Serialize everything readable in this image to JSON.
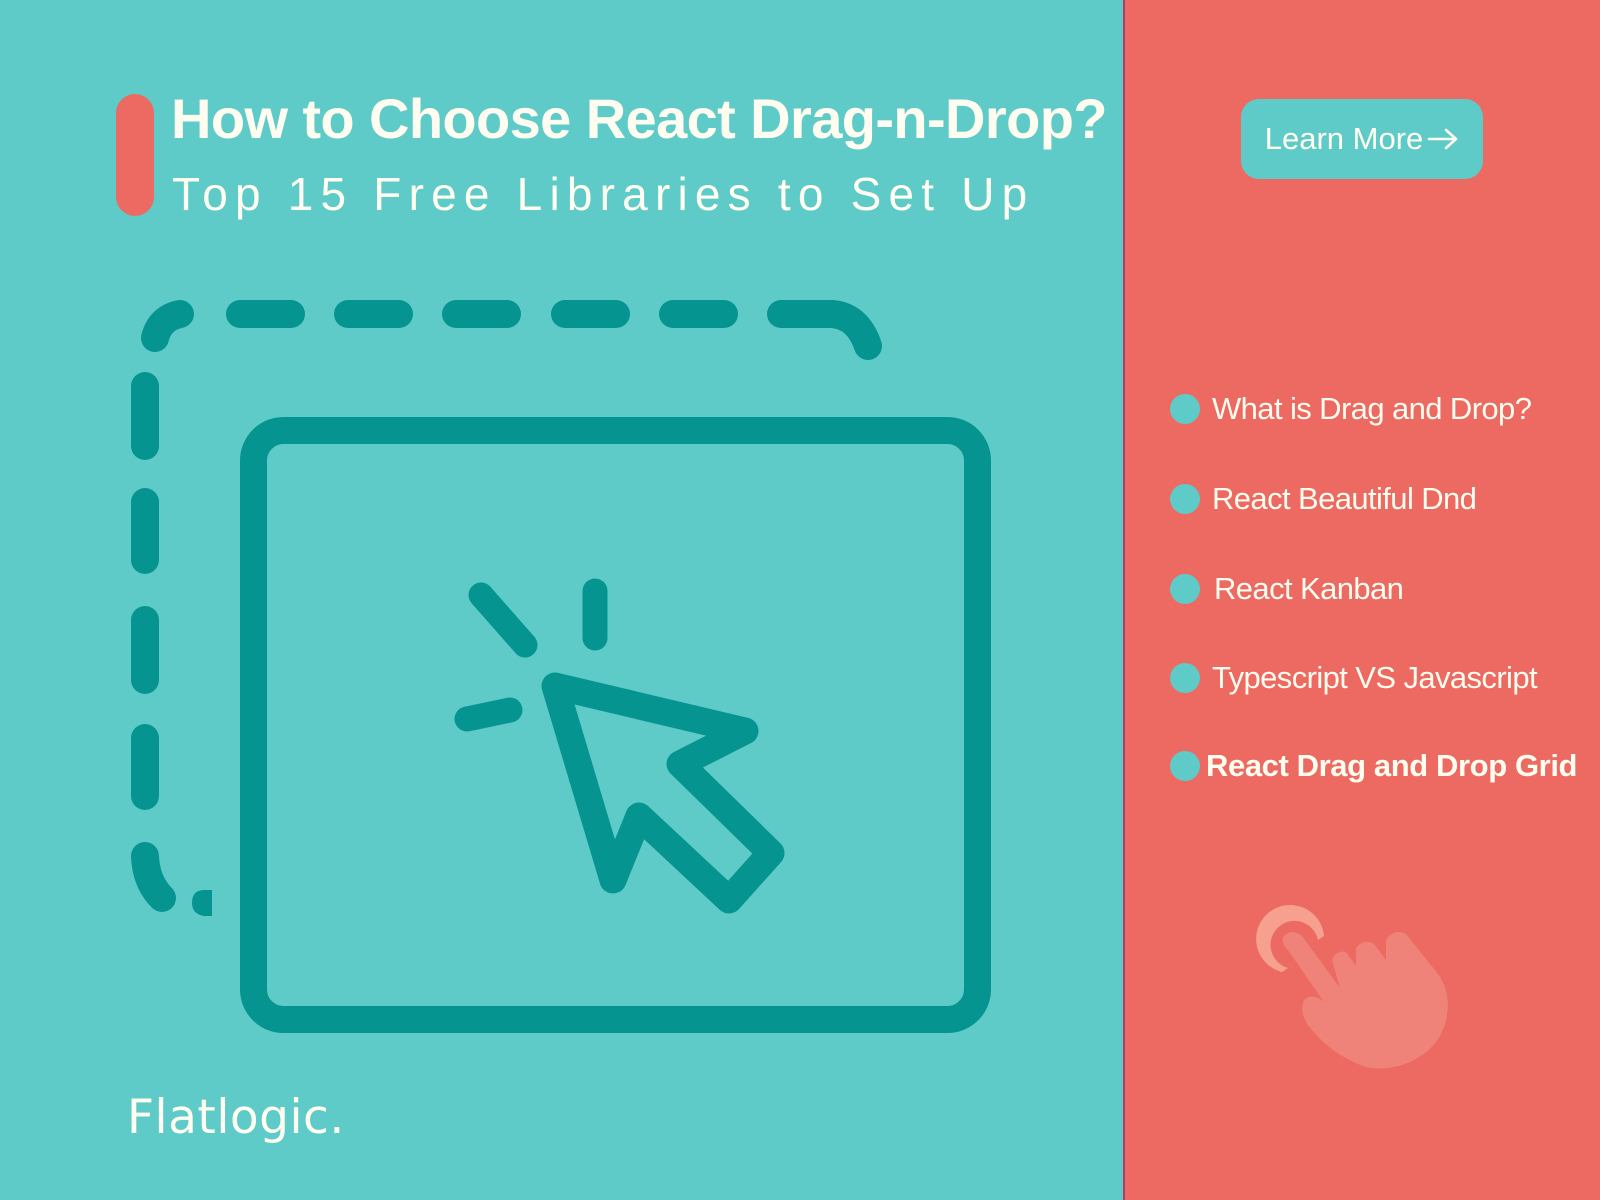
{
  "header": {
    "title": "How to Choose React Drag-n-Drop?",
    "subtitle": "Top 15 Free Libraries to Set Up"
  },
  "cta": {
    "label": "Learn More",
    "icon": "arrow-right-icon"
  },
  "toc": {
    "items": [
      {
        "label": "What is Drag and Drop?"
      },
      {
        "label": "React Beautiful Dnd"
      },
      {
        "label": "React Kanban"
      },
      {
        "label": "Typescript VS Javascript"
      },
      {
        "label": "React Drag and Drop Grid"
      }
    ]
  },
  "illustration": {
    "icon": "drag-drop-cursor-icon"
  },
  "decoration": {
    "icon": "tap-hand-icon"
  },
  "brand": {
    "logo_text": "Flatlogic."
  },
  "colors": {
    "teal_background": "#5ecbc8",
    "teal_dark": "#069491",
    "coral_background": "#ec6a62",
    "text_cream": "#fffdf0",
    "hand_light": "#f08379",
    "hand_ripple": "#f7a08f"
  }
}
